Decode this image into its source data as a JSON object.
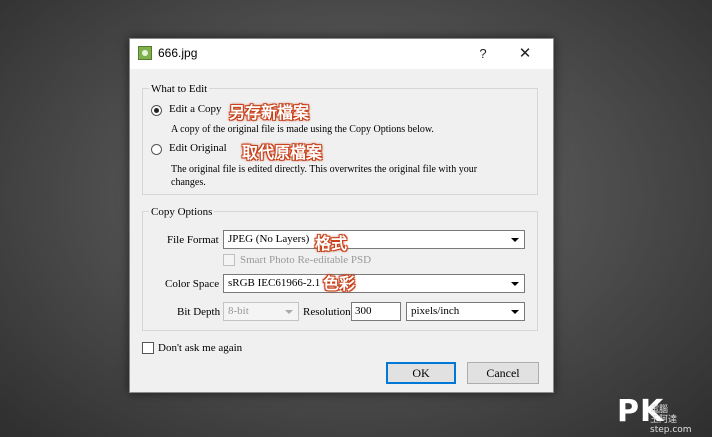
{
  "window": {
    "title": "666.jpg",
    "help_label": "?",
    "close_label": "✕",
    "icon": "image-file-icon"
  },
  "what_to_edit": {
    "group_title": "What to Edit",
    "edit_copy": {
      "label": "Edit a Copy",
      "description": "A copy of the original file is made using the Copy Options below.",
      "selected": true,
      "annotation": "另存新檔案"
    },
    "edit_original": {
      "label": "Edit Original",
      "description_line1": "The original file is edited directly.  This overwrites the original file with your",
      "description_line2": "changes.",
      "selected": false,
      "annotation": "取代原檔案"
    }
  },
  "copy_options": {
    "group_title": "Copy Options",
    "file_format": {
      "label": "File Format",
      "value": "JPEG (No Layers)",
      "annotation": "格式"
    },
    "smart_photo": {
      "label": "Smart Photo Re-editable PSD",
      "checked": false,
      "disabled": true
    },
    "color_space": {
      "label": "Color Space",
      "value": "sRGB IEC61966-2.1",
      "annotation": "色彩"
    },
    "bit_depth": {
      "label": "Bit Depth",
      "value": "8-bit",
      "disabled": true
    },
    "resolution": {
      "label": "Resolution",
      "value": "300",
      "unit": "pixels/inch"
    }
  },
  "dont_ask": {
    "label": "Don't ask me again",
    "checked": false
  },
  "buttons": {
    "ok": "OK",
    "cancel": "Cancel"
  },
  "watermark": {
    "logo": "PK",
    "sub_line1": "電腦",
    "sub_line2": "王阿達",
    "sub_line3": "step.com"
  }
}
